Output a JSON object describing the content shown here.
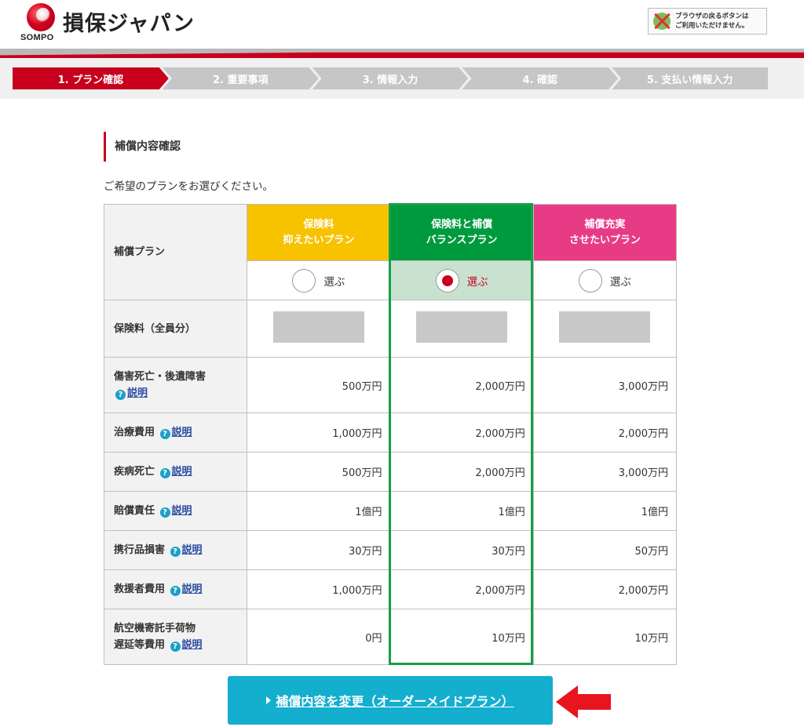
{
  "header": {
    "logo_text": "SOMPO",
    "brand_name": "損保ジャパン",
    "notice_line1": "ブラウザの戻るボタンは",
    "notice_line2": "ご利用いただけません。"
  },
  "steps": [
    {
      "label": "1. プラン確認",
      "active": true
    },
    {
      "label": "2. 重要事項",
      "active": false
    },
    {
      "label": "3. 情報入力",
      "active": false
    },
    {
      "label": "4. 確認",
      "active": false
    },
    {
      "label": "5. 支払い情報入力",
      "active": false
    }
  ],
  "section": {
    "title": "補償内容確認",
    "lead": "ご希望のプランをお選びください。"
  },
  "table": {
    "plan_row_label": "補償プラン",
    "plans": [
      {
        "line1": "保険料",
        "line2": "抑えたいプラン",
        "color": "#f7c200",
        "selected": false
      },
      {
        "line1": "保険料と補償",
        "line2": "バランスプラン",
        "color": "#009a3e",
        "selected": true
      },
      {
        "line1": "補償充実",
        "line2": "させたいプラン",
        "color": "#e83b86",
        "selected": false
      }
    ],
    "select_label": "選ぶ",
    "fee_label": "保険料（全員分）",
    "help_text": "説明",
    "help_glyph": "?",
    "rows": [
      {
        "label_line1": "傷害死亡・後遺障害",
        "label_line2": "",
        "values": [
          "500万円",
          "2,000万円",
          "3,000万円"
        ]
      },
      {
        "label_line1": "治療費用",
        "label_line2": "",
        "values": [
          "1,000万円",
          "2,000万円",
          "2,000万円"
        ]
      },
      {
        "label_line1": "疾病死亡",
        "label_line2": "",
        "values": [
          "500万円",
          "2,000万円",
          "3,000万円"
        ]
      },
      {
        "label_line1": "賠償責任",
        "label_line2": "",
        "values": [
          "1億円",
          "1億円",
          "1億円"
        ]
      },
      {
        "label_line1": "携行品損害",
        "label_line2": "",
        "values": [
          "30万円",
          "30万円",
          "50万円"
        ]
      },
      {
        "label_line1": "救援者費用",
        "label_line2": "",
        "values": [
          "1,000万円",
          "2,000万円",
          "2,000万円"
        ]
      },
      {
        "label_line1": "航空機寄託手荷物",
        "label_line2": "遅延等費用",
        "values": [
          "0円",
          "10万円",
          "10万円"
        ]
      }
    ]
  },
  "cta": {
    "label": "補償内容を変更（オーダーメイドプラン）"
  },
  "colors": {
    "brand_red": "#c8001e",
    "highlight_green": "#13a04a",
    "cta_blue": "#14aecf",
    "pointer_red": "#e8141e"
  }
}
